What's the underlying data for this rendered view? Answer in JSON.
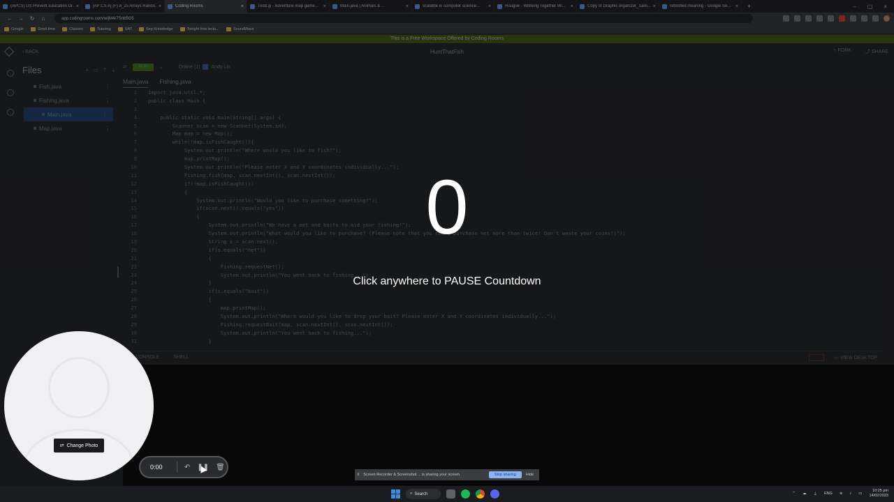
{
  "browser": {
    "tabs": [
      {
        "label": "(APCS) US Prevent Education Di..."
      },
      {
        "label": "[AP CS A] (F) 8_25 Arrays Rando..."
      },
      {
        "label": "Coding Rooms",
        "active": true
      },
      {
        "label": "Todd.gi - Adventure map game..."
      },
      {
        "label": "Main.java | Animals & ..."
      },
      {
        "label": "scalable in computer science..."
      },
      {
        "label": "Rougue - Working Together Wi..."
      },
      {
        "label": "Copy of Graphic organizer_Sam..."
      },
      {
        "label": "rebooted meaning - Google Se..."
      }
    ],
    "url": "app.codingrooms.com/w/jM4r7Snb5G5",
    "bookmarks": [
      "Google",
      "Good time",
      "Classes",
      "Tutoring",
      "SAT",
      "Sep Knowledge",
      "Tonight free lectu...",
      "SoundWave"
    ]
  },
  "app": {
    "banner": "This is a Free Workspace Offered by Coding Rooms",
    "back_label": "BACK",
    "title": "HuntThatFish",
    "fork_label": "FORK",
    "share_label": "SHARE",
    "files_title": "Files",
    "files": [
      {
        "name": "Fish.java"
      },
      {
        "name": "Fishing.java"
      },
      {
        "name": "Main.java",
        "selected": true
      },
      {
        "name": "Map.java"
      }
    ],
    "run_label": "RUN",
    "online_label": "Online (1)",
    "user_name": "Andy Lin",
    "editor_tabs": [
      "Main.java",
      "Fishing.java"
    ],
    "code_lines": [
      {
        "n": "1",
        "text": "import java.util.*;"
      },
      {
        "n": "2",
        "text": "public class Main {"
      },
      {
        "n": "3",
        "text": ""
      },
      {
        "n": "4",
        "text": "    public static void main(String[] args) {"
      },
      {
        "n": "5",
        "text": "        Scanner scan = new Scanner(System.in);"
      },
      {
        "n": "6",
        "text": "        Map map = new Map();"
      },
      {
        "n": "7",
        "text": "        while(!map.isFishCaught()){"
      },
      {
        "n": "8",
        "text": "            System.out.println(\"Where would you like to fish?\");"
      },
      {
        "n": "9",
        "text": "            map.printMap();"
      },
      {
        "n": "10",
        "text": "            System.out.println(\"Please enter X and Y coordinates individually...\");"
      },
      {
        "n": "11",
        "text": "            Fishing.fish(map, scan.nextInt(), scan.nextInt());"
      },
      {
        "n": "12",
        "text": "            if(!map.isFishCaught())"
      },
      {
        "n": "13",
        "text": "            {"
      },
      {
        "n": "14",
        "text": "                System.out.println(\"Would you like to purchase something?\");"
      },
      {
        "n": "15",
        "text": "                if(scan.next().equals(\"yes\"))"
      },
      {
        "n": "16",
        "text": "                {"
      },
      {
        "n": "17",
        "text": "                    System.out.println(\"We have a net and baits to aid your fishing!\");"
      },
      {
        "n": "18",
        "text": "                    System.out.println(\"What would you like to purchase? (Please note that you can't purchase net more than twice! Don't waste your coins!)\");"
      },
      {
        "n": "19",
        "text": "                    String s = scan.next();"
      },
      {
        "n": "20",
        "text": "                    if(s.equals(\"net\"))"
      },
      {
        "n": "21",
        "text": "                    {"
      },
      {
        "n": "22",
        "text": "                        Fishing.requestNet();"
      },
      {
        "n": "23",
        "text": "                        System.out.println(\"You went back to fishing...\");"
      },
      {
        "n": "24",
        "text": "                    }"
      },
      {
        "n": "25",
        "text": "                    if(s.equals(\"bait\"))"
      },
      {
        "n": "26",
        "text": "                    {"
      },
      {
        "n": "27",
        "text": "                        map.printMap();"
      },
      {
        "n": "28",
        "text": "                        System.out.println(\"Where would you like to drop your bait? Please enter X and Y coordinates individually...\");"
      },
      {
        "n": "29",
        "text": "                        Fishing.requestBait(map, scan.nextInt(), scan.nextInt());"
      },
      {
        "n": "30",
        "text": "                        System.out.println(\"You went back to fishing...\");"
      },
      {
        "n": "31",
        "text": "                    }"
      }
    ],
    "bottom_tabs": [
      "CONSOLE",
      "SHELL"
    ],
    "view_desktop_label": "VIEW DESKTOP"
  },
  "overlay": {
    "countdown": "0",
    "hint": "Click anywhere to PAUSE Countdown"
  },
  "camera": {
    "change_photo_label": "Change Photo"
  },
  "recorder": {
    "time": "0:00"
  },
  "share_bar": {
    "message": "Screen Recorder & Screenshot ... is sharing your screen.",
    "stop_label": "Stop sharing",
    "hide_label": "Hide"
  },
  "taskbar": {
    "search_label": "Search",
    "lang": "ENG",
    "time": "10:25 pm",
    "date": "14/02/2023"
  },
  "colors": {
    "run": "#3b6b1e",
    "selected_file": "#1e3d66",
    "stop_sharing": "#8ab4f8"
  }
}
